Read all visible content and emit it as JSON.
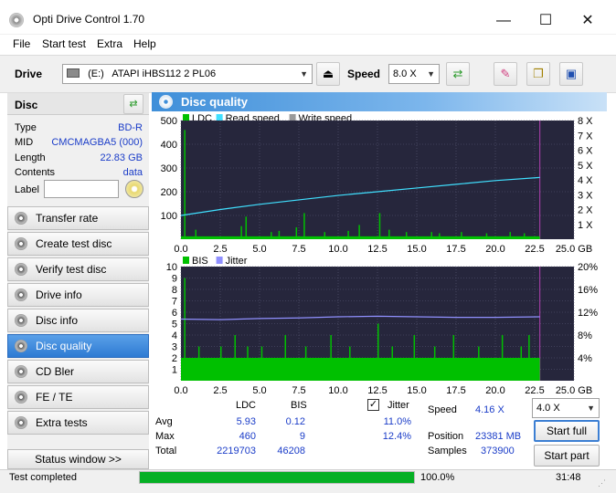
{
  "window": {
    "title": "Opti Drive Control 1.70",
    "minimize": "—",
    "maximize": "☐",
    "close": "✕"
  },
  "menu": [
    "File",
    "Start test",
    "Extra",
    "Help"
  ],
  "toolbar": {
    "drive_label": "Drive",
    "drive_letter": "(E:)",
    "drive_name": "ATAPI  iHBS112   2 PL06",
    "speed_label": "Speed",
    "speed_value": "8.0 X"
  },
  "disc": {
    "header": "Disc",
    "type_label": "Type",
    "type_value": "BD-R",
    "mid_label": "MID",
    "mid_value": "CMCMAGBA5 (000)",
    "length_label": "Length",
    "length_value": "22.83 GB",
    "contents_label": "Contents",
    "contents_value": "data",
    "label_label": "Label",
    "label_value": ""
  },
  "nav": [
    {
      "label": "Transfer rate",
      "active": false
    },
    {
      "label": "Create test disc",
      "active": false
    },
    {
      "label": "Verify test disc",
      "active": false
    },
    {
      "label": "Drive info",
      "active": false
    },
    {
      "label": "Disc info",
      "active": false
    },
    {
      "label": "Disc quality",
      "active": true
    },
    {
      "label": "CD Bler",
      "active": false
    },
    {
      "label": "FE / TE",
      "active": false
    },
    {
      "label": "Extra tests",
      "active": false
    }
  ],
  "status_window_btn": "Status window >>",
  "main": {
    "title": "Disc quality"
  },
  "chart_data": [
    {
      "type": "bar",
      "legend": [
        "LDC",
        "Read speed",
        "Write speed"
      ],
      "colors": {
        "LDC": "#00c000",
        "Read speed": "#40e0ff",
        "Write speed": "#9a9a9a",
        "background": "#26263c"
      },
      "x_ticks": [
        "0.0",
        "2.5",
        "5.0",
        "7.5",
        "10.0",
        "12.5",
        "15.0",
        "17.5",
        "20.0",
        "22.5",
        "25.0 GB"
      ],
      "y_ticks": [
        "500",
        "400",
        "300",
        "200",
        "100"
      ],
      "y2_ticks": [
        "8 X",
        "7 X",
        "6 X",
        "5 X",
        "4 X",
        "3 X",
        "2 X",
        "1 X"
      ],
      "xlim": [
        0,
        25
      ],
      "ylim": [
        0,
        500
      ],
      "y2lim": [
        0,
        8
      ],
      "disc_end_gb": 22.83,
      "read_speed_x": [
        0,
        2.5,
        5,
        7.5,
        10,
        12.5,
        15,
        17.5,
        20,
        22.83
      ],
      "read_speed_y": [
        1.6,
        2.0,
        2.35,
        2.65,
        2.95,
        3.2,
        3.45,
        3.7,
        3.95,
        4.16
      ],
      "ldc_baseline": 12,
      "ldc_spikes": [
        [
          0.2,
          460
        ],
        [
          0.9,
          40
        ],
        [
          3.8,
          55
        ],
        [
          4.1,
          95
        ],
        [
          5.7,
          30
        ],
        [
          6.2,
          35
        ],
        [
          7.3,
          50
        ],
        [
          7.8,
          110
        ],
        [
          9.1,
          30
        ],
        [
          10.6,
          35
        ],
        [
          11.3,
          60
        ],
        [
          12.6,
          110
        ],
        [
          13.2,
          40
        ],
        [
          14.3,
          30
        ],
        [
          15.9,
          30
        ],
        [
          16.4,
          25
        ],
        [
          17.8,
          30
        ],
        [
          19.4,
          25
        ],
        [
          20.9,
          30
        ],
        [
          21.8,
          25
        ]
      ]
    },
    {
      "type": "bar",
      "legend": [
        "BIS",
        "Jitter"
      ],
      "colors": {
        "BIS": "#00c000",
        "Jitter": "#9090ff",
        "background": "#26263c"
      },
      "x_ticks": [
        "0.0",
        "2.5",
        "5.0",
        "7.5",
        "10.0",
        "12.5",
        "15.0",
        "17.5",
        "20.0",
        "22.5",
        "25.0 GB"
      ],
      "y_ticks": [
        "10",
        "9",
        "8",
        "7",
        "6",
        "5",
        "4",
        "3",
        "2",
        "1"
      ],
      "y2_ticks": [
        "20%",
        "16%",
        "12%",
        "8%",
        "4%"
      ],
      "xlim": [
        0,
        25
      ],
      "ylim": [
        0,
        10
      ],
      "y2lim": [
        0,
        20
      ],
      "disc_end_gb": 22.83,
      "bis_baseline": 2,
      "bis_spikes": [
        [
          0.2,
          9
        ],
        [
          1.1,
          3
        ],
        [
          2.5,
          3
        ],
        [
          3.4,
          4
        ],
        [
          4.2,
          3
        ],
        [
          5.1,
          3
        ],
        [
          6.6,
          4
        ],
        [
          7.9,
          3
        ],
        [
          9.5,
          4
        ],
        [
          10.7,
          3
        ],
        [
          12.5,
          5
        ],
        [
          13.4,
          3
        ],
        [
          14.8,
          4
        ],
        [
          16.1,
          3
        ],
        [
          17.3,
          4
        ],
        [
          18.9,
          3
        ],
        [
          20.4,
          4
        ],
        [
          21.6,
          3
        ],
        [
          22.1,
          4
        ]
      ],
      "jitter_x": [
        0,
        2.5,
        5,
        7.5,
        10,
        12.5,
        15,
        17.5,
        20,
        22.83
      ],
      "jitter_y": [
        10.8,
        10.7,
        10.9,
        11.0,
        11.2,
        11.3,
        11.2,
        11.1,
        11.1,
        11.2
      ]
    }
  ],
  "stats": {
    "hdr_ldc": "LDC",
    "hdr_bis": "BIS",
    "jitter_label": "Jitter",
    "jitter_checked": "✓",
    "avg_label": "Avg",
    "avg_ldc": "5.93",
    "avg_bis": "0.12",
    "avg_jitter": "11.0%",
    "max_label": "Max",
    "max_ldc": "460",
    "max_bis": "9",
    "max_jitter": "12.4%",
    "total_label": "Total",
    "total_ldc": "2219703",
    "total_bis": "46208",
    "speed_label": "Speed",
    "speed_value": "4.16 X",
    "speed_select": "4.0 X",
    "position_label": "Position",
    "position_value": "23381 MB",
    "samples_label": "Samples",
    "samples_value": "373900",
    "start_full": "Start full",
    "start_part": "Start part"
  },
  "statusbar": {
    "text": "Test completed",
    "progress_percent": 100,
    "progress_text": "100.0%",
    "time": "31:48"
  }
}
